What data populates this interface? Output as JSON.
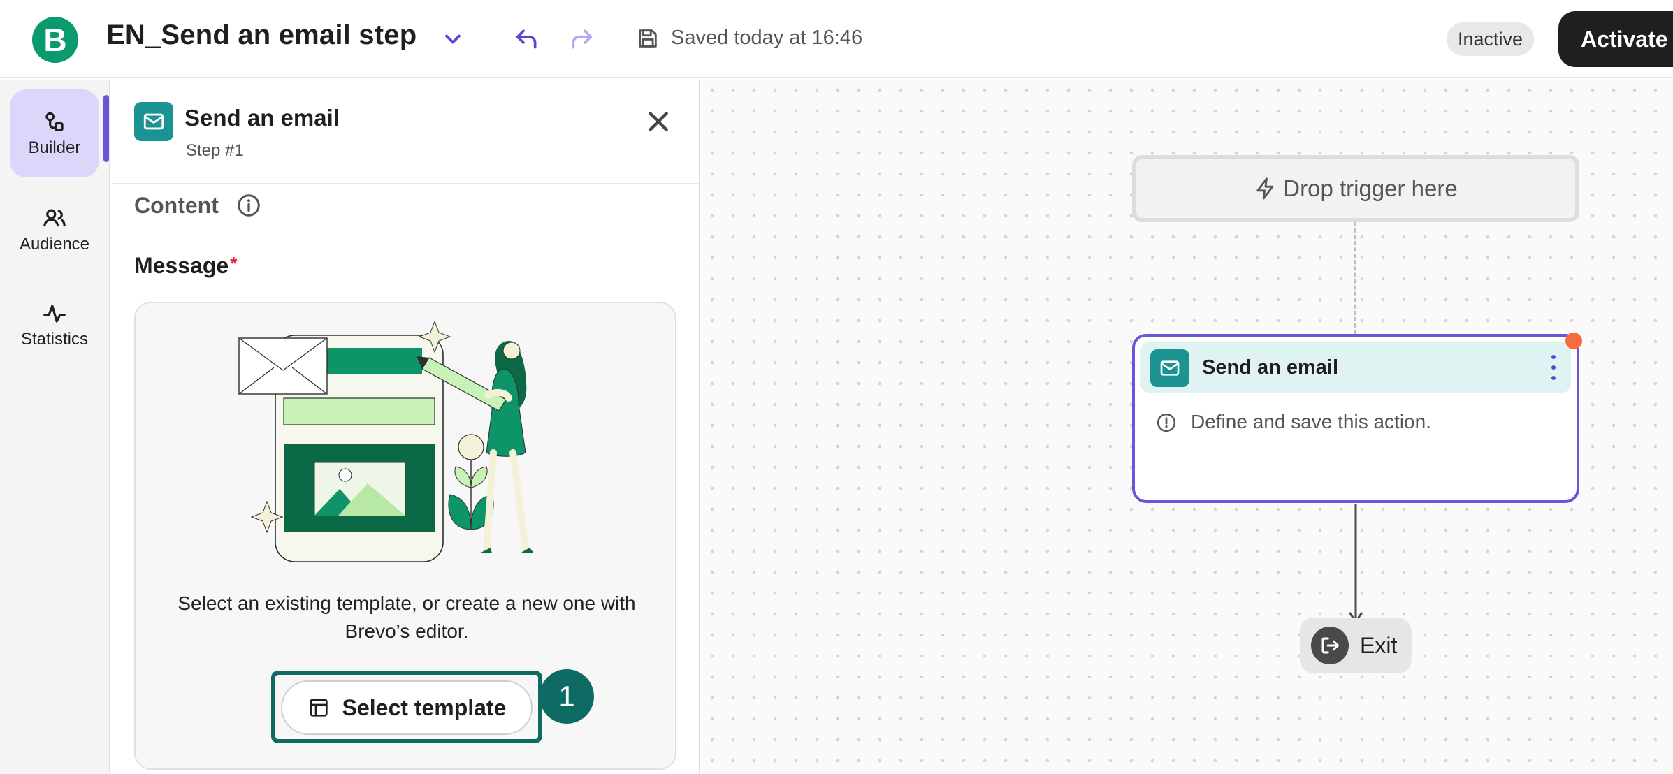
{
  "header": {
    "logo_letter": "B",
    "title": "EN_Send an email step",
    "saved_text": "Saved today at 16:46",
    "status": "Inactive",
    "activate_label": "Activate",
    "brand_color": "#0b996e"
  },
  "rail": {
    "items": [
      {
        "label": "Builder",
        "icon": "builder-icon",
        "active": true
      },
      {
        "label": "Audience",
        "icon": "audience-icon",
        "active": false
      },
      {
        "label": "Statistics",
        "icon": "statistics-icon",
        "active": false
      }
    ]
  },
  "panel": {
    "title": "Send an email",
    "subtitle": "Step #1",
    "section": "Content",
    "message_label": "Message",
    "required_mark": "*",
    "template_description": "Select an existing template, or create a new one with Brevo’s editor.",
    "select_template_label": "Select template",
    "callout_number": "1"
  },
  "canvas": {
    "trigger_label": "Drop trigger here",
    "node_title": "Send an email",
    "node_message": "Define and save this action.",
    "exit_label": "Exit",
    "accent_color": "#6a55d8",
    "status_dot_color": "#f76b3c"
  }
}
